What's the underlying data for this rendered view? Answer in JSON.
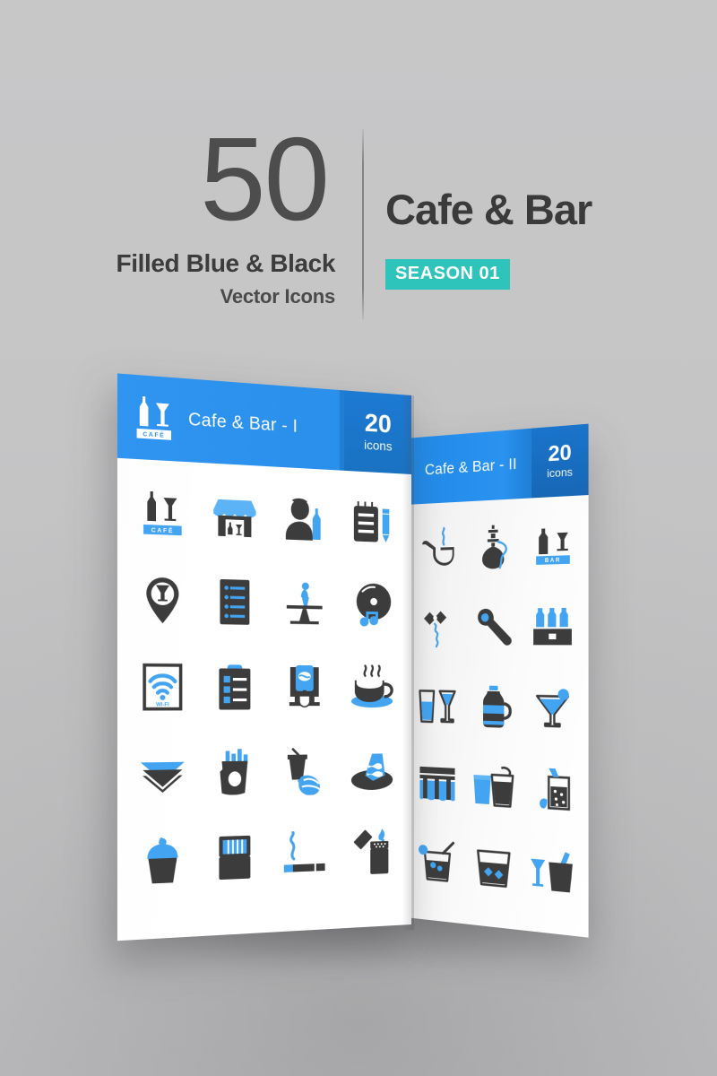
{
  "background_color": "#c4c4c5",
  "header": {
    "count": "50",
    "subtitle_line1": "Filled Blue & Black",
    "subtitle_line2": "Vector Icons",
    "title": "Cafe & Bar",
    "season_badge": "SEASON 01",
    "accent_blue": "#2a90ec",
    "accent_teal": "#2ec4bc",
    "text_dark": "#3a3a3a"
  },
  "panels": {
    "front": {
      "title": "Cafe & Bar - I",
      "badge_count": "20",
      "badge_label": "icons",
      "logo_label": "CAFÉ",
      "icons": [
        {
          "name": "cafe-sign-icon",
          "label": "Cafe sign with bottle and glass"
        },
        {
          "name": "cafe-storefront-icon",
          "label": "Cafe storefront with awning"
        },
        {
          "name": "waiter-icon",
          "label": "Waiter with wine bottle"
        },
        {
          "name": "notepad-pencil-icon",
          "label": "Order notepad with pencil"
        },
        {
          "name": "location-pin-glass-icon",
          "label": "Location pin with glass"
        },
        {
          "name": "menu-list-icon",
          "label": "Menu list"
        },
        {
          "name": "table-flower-vase-icon",
          "label": "Table with flower vase"
        },
        {
          "name": "vinyl-record-music-icon",
          "label": "Vinyl record with music notes"
        },
        {
          "name": "wifi-sign-icon",
          "label": "Free WiFi framed sign"
        },
        {
          "name": "clipboard-checklist-icon",
          "label": "Order clipboard checklist"
        },
        {
          "name": "coffee-machine-icon",
          "label": "Coffee machine"
        },
        {
          "name": "coffee-cup-icon",
          "label": "Hot coffee cup on saucer"
        },
        {
          "name": "sandwich-icon",
          "label": "Sandwich"
        },
        {
          "name": "french-fries-icon",
          "label": "French fries"
        },
        {
          "name": "soda-burger-icon",
          "label": "Soda cup with burger"
        },
        {
          "name": "cake-slice-icon",
          "label": "Cake slice on plate"
        },
        {
          "name": "ice-cream-cup-icon",
          "label": "Ice cream in cup"
        },
        {
          "name": "cigarette-pack-icon",
          "label": "Cigarette pack"
        },
        {
          "name": "cigarette-smoke-icon",
          "label": "Lit cigarette with smoke"
        },
        {
          "name": "lighter-icon",
          "label": "Flip lighter with flame"
        }
      ]
    },
    "right": {
      "title": "Cafe & Bar - II",
      "badge_count": "20",
      "badge_label": "icons",
      "bar_sign_label": "BAR",
      "icons": [
        {
          "name": "smoking-pipe-icon",
          "label": "Smoking pipe"
        },
        {
          "name": "hookah-icon",
          "label": "Hookah shisha"
        },
        {
          "name": "bar-sign-icon",
          "label": "Bar sign with bottle and glass"
        },
        {
          "name": "corkscrew-icon",
          "label": "Corkscrew"
        },
        {
          "name": "bottle-opener-icon",
          "label": "Bottle opener"
        },
        {
          "name": "beer-crate-icon",
          "label": "Beer crate with bottles"
        },
        {
          "name": "beer-glasses-icon",
          "label": "Beer glass and wine glass"
        },
        {
          "name": "water-jug-icon",
          "label": "Water jug bottle"
        },
        {
          "name": "cocktail-glass-icon",
          "label": "Cocktail glass with fruit"
        },
        {
          "name": "beer-tap-dispenser-icon",
          "label": "Beer tap dispenser"
        },
        {
          "name": "iced-drinks-icon",
          "label": "Two iced drinks with straw"
        },
        {
          "name": "soda-glass-straw-icon",
          "label": "Soda glass with straw and lemon"
        },
        {
          "name": "cocktail-straw-icon",
          "label": "Cocktail with straw and lemon"
        },
        {
          "name": "whiskey-rocks-icon",
          "label": "Whiskey glass with ice cubes"
        },
        {
          "name": "champagne-bucket-icon",
          "label": "Champagne bucket with glass"
        }
      ]
    }
  }
}
